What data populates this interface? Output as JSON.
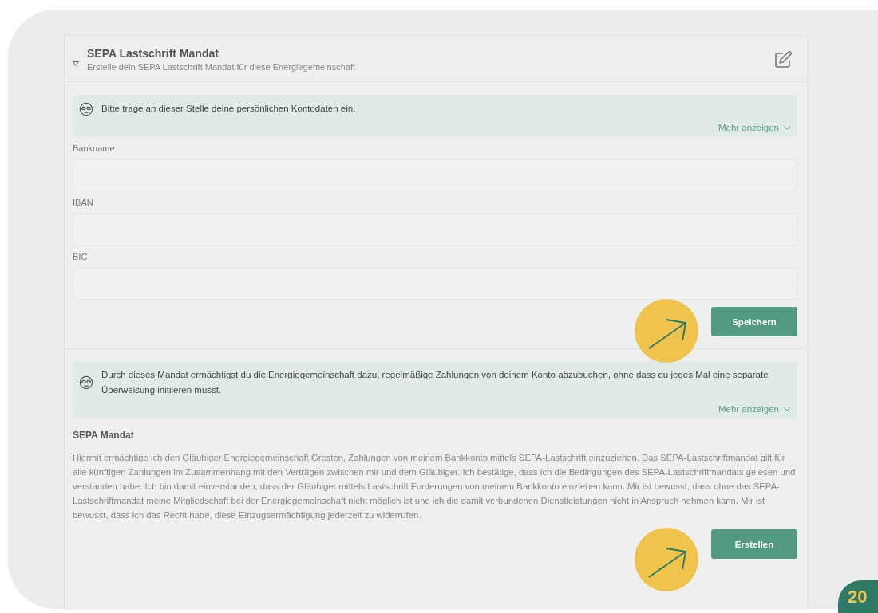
{
  "section": {
    "title": "SEPA Lastschrift Mandat",
    "subtitle": "Erstelle dein SEPA Lastschrift Mandat für diese Energiegemeinschaft",
    "expanded": true
  },
  "bank_info": {
    "text": "Bitte trage an dieser Stelle deine persönlichen Kontodaten ein.",
    "more": "Mehr anzeigen"
  },
  "fields": [
    {
      "label": "Bankname"
    },
    {
      "label": "IBAN"
    },
    {
      "label": "BIC"
    }
  ],
  "save_button": "Speichern",
  "mandate_info": {
    "text": "Durch dieses Mandat ermächtigst du die Energiegemeinschaft dazu, regelmäßige Zahlungen von deinem Konto abzubuchen, ohne dass du jedes Mal eine separate Überweisung initiieren musst.",
    "more": "Mehr anzeigen"
  },
  "mandate": {
    "heading": "SEPA Mandat",
    "text": "Hiermit ermächtige ich den Gläubiger Energiegemeinschaft Gresten, Zahlungen von meinem Bankkonto mittels SEPA-Lastschrift einzuziehen. Das SEPA-Lastschriftmandat gilt für alle künftigen Zahlungen im Zusammenhang mit den Verträgen zwischen mir und dem Gläubiger. Ich bestätige, dass ich die Bedingungen des SEPA-Lastschriftmandats gelesen und verstanden habe. Ich bin damit einverstanden, dass der Gläubiger mittels Lastschrift Forderungen von meinem Bankkonto einziehen kann. Mir ist bewusst, dass ohne das SEPA-Lastschriftmandat meine Mitgliedschaft bei der Energiegemeinschaft nicht möglich ist und ich die damit verbundenen Dienstleistungen nicht in Anspruch nehmen kann. Mir ist bewusst, dass ich das Recht habe, diese Einzugsermächtigung jederzeit zu widerrufen."
  },
  "create_button": "Erstellen",
  "page_number": "20"
}
